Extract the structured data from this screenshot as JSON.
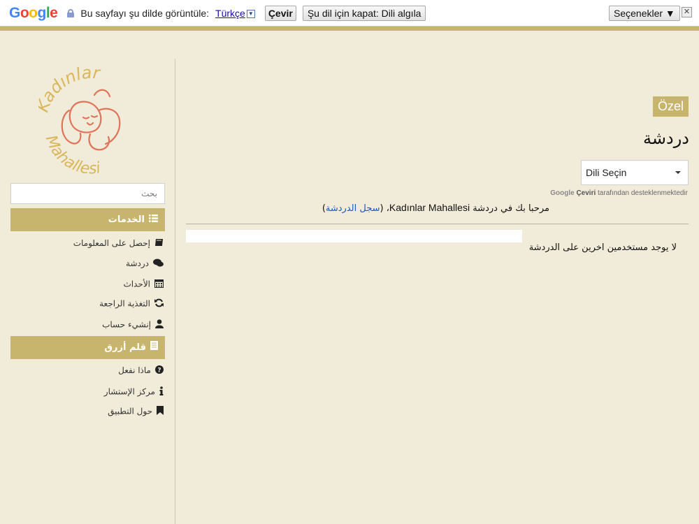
{
  "translate_bar": {
    "logo": "Google",
    "prompt": "Bu sayfayı şu dilde görüntüle:",
    "language": "Türkçe",
    "translate_button": "Çevir",
    "turn_off_button": "Şu dil için kapat: Dili algıla",
    "options_button": "Seçenekler ▼",
    "close": "✕"
  },
  "sidebar": {
    "logo_top": "Kadınlar",
    "logo_bottom": "Mahallesi",
    "search_placeholder": "بحث",
    "services_title": "الخدمات",
    "services": [
      {
        "label": "إحصل على المعلومات",
        "icon": "book-icon"
      },
      {
        "label": "دردشة",
        "icon": "comments-icon"
      },
      {
        "label": "الأحداث",
        "icon": "calendar-icon"
      },
      {
        "label": "التغذية الراجعة",
        "icon": "refresh-icon"
      },
      {
        "label": "إنشيء حساب",
        "icon": "user-icon"
      }
    ],
    "bluepen_title": "قلم أزرق",
    "bluepen": [
      {
        "label": "ماذا نفعل",
        "icon": "question-icon"
      },
      {
        "label": "مركز الإستشار",
        "icon": "info-icon"
      },
      {
        "label": "حول التطبيق",
        "icon": "bookmark-icon"
      }
    ]
  },
  "main": {
    "badge": "Özel",
    "title": "دردشة",
    "language_select": "Dili Seçin",
    "powered_by_brand": "Google",
    "powered_by_word": "Çeviri",
    "powered_by_suffix": "tarafından desteklenmektedir",
    "welcome_prefix": "مرحبا بك في دردشة",
    "welcome_site": "Kadınlar Mahallesi",
    "welcome_link": "سجل الدردشة",
    "no_users": "لا يوجد مستخدمين اخرين على الدردشة"
  },
  "colors": {
    "accent": "#c7b46d",
    "background": "#f1ecd9",
    "logo_red": "#e0735a",
    "logo_gold": "#d9b65a"
  }
}
